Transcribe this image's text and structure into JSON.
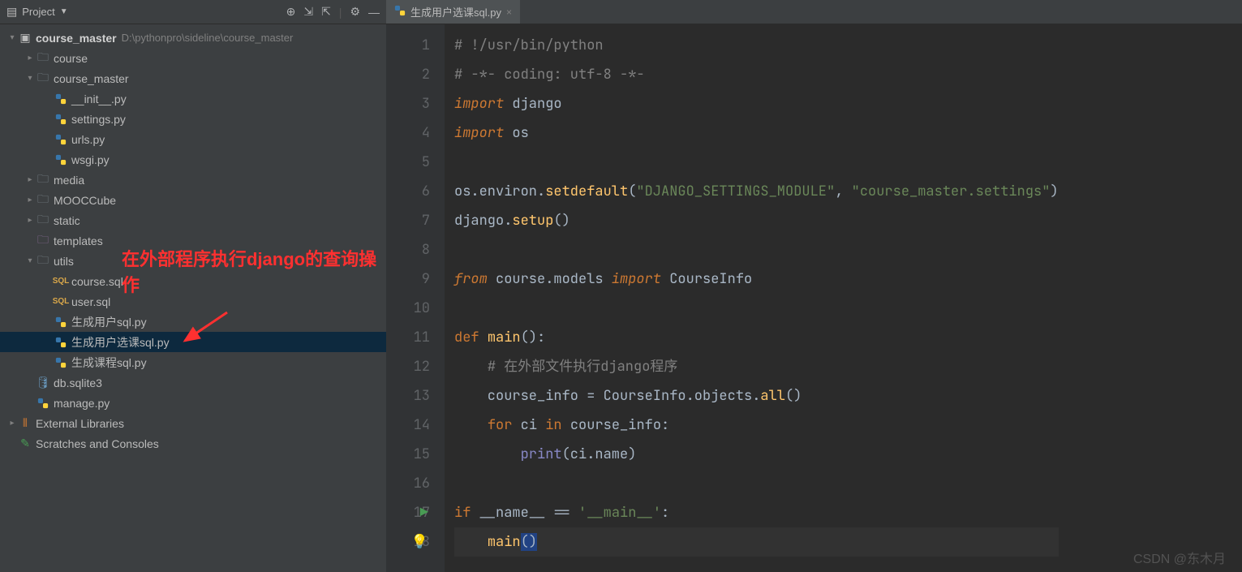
{
  "sidebar": {
    "title": "Project",
    "root": {
      "label": "course_master",
      "path": "D:\\pythonpro\\sideline\\course_master"
    },
    "tree": [
      {
        "indent": 1,
        "arrow": "▸",
        "icon": "folder",
        "label": "course"
      },
      {
        "indent": 1,
        "arrow": "▾",
        "icon": "folder",
        "label": "course_master"
      },
      {
        "indent": 2,
        "arrow": "",
        "icon": "py",
        "label": "__init__.py"
      },
      {
        "indent": 2,
        "arrow": "",
        "icon": "py",
        "label": "settings.py"
      },
      {
        "indent": 2,
        "arrow": "",
        "icon": "py",
        "label": "urls.py"
      },
      {
        "indent": 2,
        "arrow": "",
        "icon": "py",
        "label": "wsgi.py"
      },
      {
        "indent": 1,
        "arrow": "▸",
        "icon": "folder",
        "label": "media"
      },
      {
        "indent": 1,
        "arrow": "▸",
        "icon": "folder",
        "label": "MOOCCube"
      },
      {
        "indent": 1,
        "arrow": "▸",
        "icon": "folder",
        "label": "static"
      },
      {
        "indent": 1,
        "arrow": "",
        "icon": "folder-purple",
        "label": "templates"
      },
      {
        "indent": 1,
        "arrow": "▾",
        "icon": "folder",
        "label": "utils"
      },
      {
        "indent": 2,
        "arrow": "",
        "icon": "sql",
        "label": "course.sql"
      },
      {
        "indent": 2,
        "arrow": "",
        "icon": "sql",
        "label": "user.sql"
      },
      {
        "indent": 2,
        "arrow": "",
        "icon": "py",
        "label": "生成用户sql.py"
      },
      {
        "indent": 2,
        "arrow": "",
        "icon": "py",
        "label": "生成用户选课sql.py",
        "selected": true
      },
      {
        "indent": 2,
        "arrow": "",
        "icon": "py",
        "label": "生成课程sql.py"
      },
      {
        "indent": 1,
        "arrow": "",
        "icon": "db",
        "label": "db.sqlite3"
      },
      {
        "indent": 1,
        "arrow": "",
        "icon": "py",
        "label": "manage.py"
      }
    ],
    "external": "External Libraries",
    "scratches": "Scratches and Consoles"
  },
  "annotation": "在外部程序执行django的查询操作",
  "tab": {
    "label": "生成用户选课sql.py"
  },
  "code": {
    "lines": [
      {
        "n": 1,
        "html": "<span class='cm'># !/usr/bin/python</span>"
      },
      {
        "n": 2,
        "html": "<span class='cm'># -*- coding: utf-8 -*-</span>"
      },
      {
        "n": 3,
        "html": "<span class='kw'>import</span> django"
      },
      {
        "n": 4,
        "html": "<span class='kw'>import</span> os"
      },
      {
        "n": 5,
        "html": ""
      },
      {
        "n": 6,
        "html": "os.environ.<span class='fn'>setdefault</span>(<span class='str'>\"DJANGO_SETTINGS_MODULE\"</span>, <span class='str'>\"course_master.settings\"</span>)"
      },
      {
        "n": 7,
        "html": "django.<span class='fn'>setup</span>()"
      },
      {
        "n": 8,
        "html": ""
      },
      {
        "n": 9,
        "html": "<span class='kw'>from</span> course.models <span class='kw'>import</span> CourseInfo"
      },
      {
        "n": 10,
        "html": ""
      },
      {
        "n": 11,
        "html": "<span class='kw-n'>def</span> <span class='fn'>main</span>():"
      },
      {
        "n": 12,
        "html": "    <span class='cm'># 在外部文件执行django程序</span>"
      },
      {
        "n": 13,
        "html": "    course_info = CourseInfo.objects.<span class='fn'>all</span>()"
      },
      {
        "n": 14,
        "html": "    <span class='kw-n'>for</span> ci <span class='kw-n'>in</span> course_info:"
      },
      {
        "n": 15,
        "html": "        <span class='builtin'>print</span>(ci.name)"
      },
      {
        "n": 16,
        "html": ""
      },
      {
        "n": 17,
        "html": "<span class='kw-n'>if</span> __name__ == <span class='str'>'__main__'</span>:",
        "play": true
      },
      {
        "n": 18,
        "html": "    <span class='fn'>main</span><span class='caret-bg'>()</span>",
        "current": true,
        "bulb": true
      }
    ]
  },
  "watermark": "CSDN @东木月"
}
